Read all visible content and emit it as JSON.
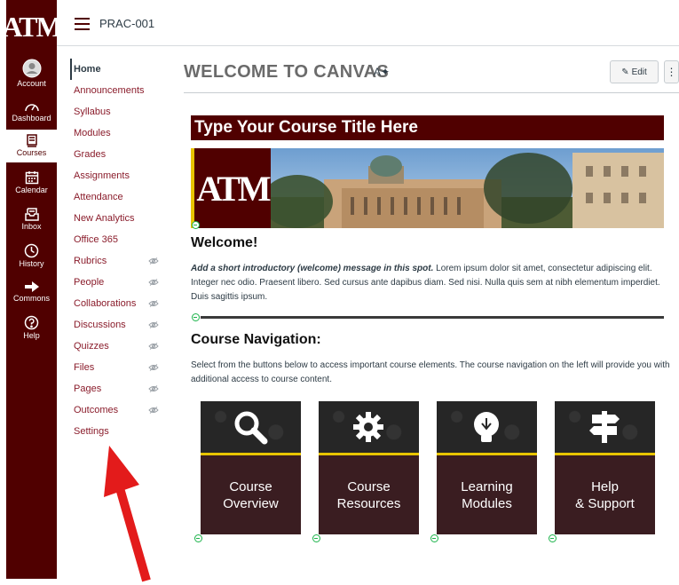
{
  "global_nav": {
    "logo": "ATM",
    "items": [
      {
        "label": "Account",
        "icon": "account-icon"
      },
      {
        "label": "Dashboard",
        "icon": "dashboard-icon"
      },
      {
        "label": "Courses",
        "icon": "courses-icon",
        "active": true
      },
      {
        "label": "Calendar",
        "icon": "calendar-icon"
      },
      {
        "label": "Inbox",
        "icon": "inbox-icon"
      },
      {
        "label": "History",
        "icon": "history-icon"
      },
      {
        "label": "Commons",
        "icon": "commons-icon"
      },
      {
        "label": "Help",
        "icon": "help-icon"
      }
    ]
  },
  "topbar": {
    "breadcrumb": "PRAC-001"
  },
  "course_nav": {
    "items": [
      {
        "label": "Home",
        "active": true,
        "hidden": false
      },
      {
        "label": "Announcements",
        "hidden": false
      },
      {
        "label": "Syllabus",
        "hidden": false
      },
      {
        "label": "Modules",
        "hidden": false
      },
      {
        "label": "Grades",
        "hidden": false
      },
      {
        "label": "Assignments",
        "hidden": false
      },
      {
        "label": "Attendance",
        "hidden": false
      },
      {
        "label": "New Analytics",
        "hidden": false
      },
      {
        "label": "Office 365",
        "hidden": false
      },
      {
        "label": "Rubrics",
        "hidden": true
      },
      {
        "label": "People",
        "hidden": true
      },
      {
        "label": "Collaborations",
        "hidden": true
      },
      {
        "label": "Discussions",
        "hidden": true
      },
      {
        "label": "Quizzes",
        "hidden": true
      },
      {
        "label": "Files",
        "hidden": true
      },
      {
        "label": "Pages",
        "hidden": true
      },
      {
        "label": "Outcomes",
        "hidden": true
      },
      {
        "label": "Settings",
        "hidden": false
      }
    ]
  },
  "main": {
    "page_title": "WELCOME TO CANVAS",
    "edit_label": "Edit",
    "more_label": "⋮",
    "course_title": "Type Your Course Title Here",
    "banner_logo": "ATM",
    "welcome_heading": "Welcome!",
    "welcome_bold": "Add a short introductory (welcome) message in this spot.",
    "welcome_body": " Lorem ipsum dolor sit amet, consectetur adipiscing elit. Integer nec odio. Praesent libero. Sed cursus ante dapibus diam. Sed nisi. Nulla quis sem at nibh elementum imperdiet. Duis sagittis ipsum.",
    "nav_heading": "Course Navigation:",
    "nav_text": "Select from the buttons below to access important course elements. The course navigation on the left will provide you with additional access to course content.",
    "tiles": [
      {
        "label": "Course Overview",
        "icon": "magnifier-icon"
      },
      {
        "label": "Course Resources",
        "icon": "gear-icon"
      },
      {
        "label": "Learning Modules",
        "icon": "lightbulb-icon"
      },
      {
        "label": "Help & Support",
        "icon": "signpost-icon"
      }
    ]
  },
  "colors": {
    "maroon": "#500000",
    "gold": "#e8c400",
    "link": "#8a1c2b",
    "annotation_arrow": "#e31b1b"
  }
}
